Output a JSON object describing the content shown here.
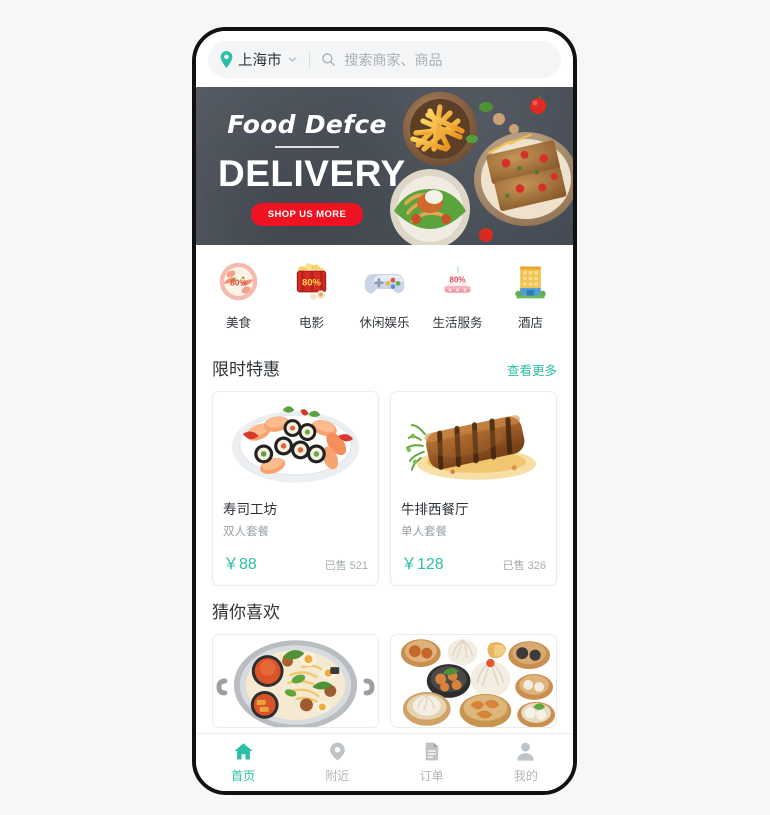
{
  "theme": {
    "accent": "#2bbfa6",
    "banner_button": "#ef1220",
    "page_background": "#f7f7f7",
    "text_primary": "#2c3136",
    "text_muted": "#9aa0a5"
  },
  "header": {
    "location_label": "上海市",
    "location_icon": "map-pin-icon",
    "chevron_icon": "chevron-down-icon",
    "search_icon": "search-icon",
    "search_value": "",
    "search_placeholder": "搜索商家、商品"
  },
  "banner": {
    "script_text": "Food Defce",
    "headline": "DELIVERY",
    "button_label": "SHOP US MORE",
    "image_alt": "food-delivery-photo"
  },
  "categories": [
    {
      "label": "美食",
      "icon": "food-bowl-icon"
    },
    {
      "label": "电影",
      "icon": "movie-ticket-icon"
    },
    {
      "label": "休闲娱乐",
      "icon": "game-controller-icon"
    },
    {
      "label": "生活服务",
      "icon": "life-service-cake-icon"
    },
    {
      "label": "酒店",
      "icon": "hotel-building-icon"
    }
  ],
  "deals_section": {
    "title": "限时特惠",
    "more_label": "查看更多",
    "items": [
      {
        "name": "寿司工坊",
        "subtitle": "双人套餐",
        "price": "￥88",
        "sold": "已售 521",
        "image_alt": "sushi-platter-photo"
      },
      {
        "name": "牛排西餐厅",
        "subtitle": "单人套餐",
        "price": "￥128",
        "sold": "已售 326",
        "image_alt": "grilled-steak-photo"
      }
    ]
  },
  "guess_section": {
    "title": "猜你喜欢",
    "items": [
      {
        "image_alt": "hotpot-noodle-photo"
      },
      {
        "image_alt": "dimsum-basket-photo"
      }
    ]
  },
  "tabbar": [
    {
      "label": "首页",
      "icon": "home-icon",
      "active": true
    },
    {
      "label": "附近",
      "icon": "map-pin-icon",
      "active": false
    },
    {
      "label": "订单",
      "icon": "document-icon",
      "active": false
    },
    {
      "label": "我的",
      "icon": "person-icon",
      "active": false
    }
  ]
}
